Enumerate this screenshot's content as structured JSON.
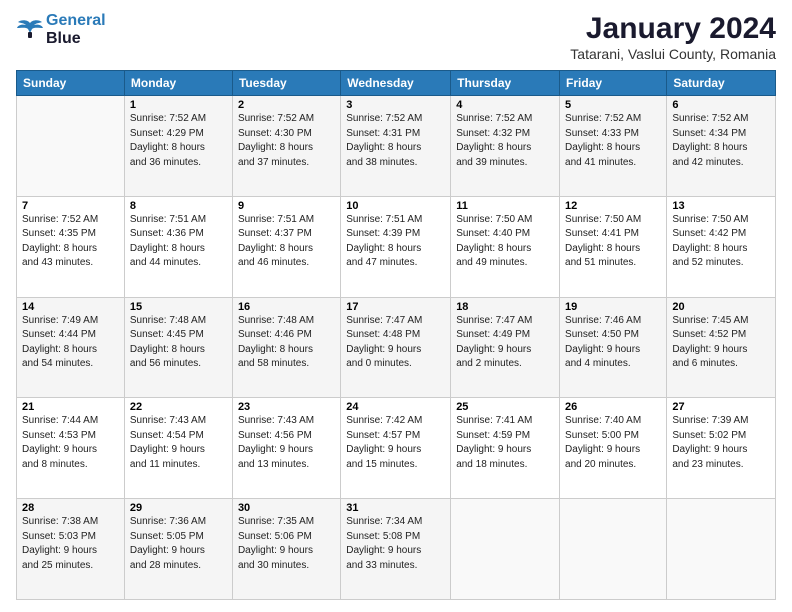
{
  "header": {
    "logo_line1": "General",
    "logo_line2": "Blue",
    "title": "January 2024",
    "subtitle": "Tatarani, Vaslui County, Romania"
  },
  "weekdays": [
    "Sunday",
    "Monday",
    "Tuesday",
    "Wednesday",
    "Thursday",
    "Friday",
    "Saturday"
  ],
  "weeks": [
    [
      {
        "day": "",
        "sunrise": "",
        "sunset": "",
        "daylight": ""
      },
      {
        "day": "1",
        "sunrise": "Sunrise: 7:52 AM",
        "sunset": "Sunset: 4:29 PM",
        "daylight": "Daylight: 8 hours and 36 minutes."
      },
      {
        "day": "2",
        "sunrise": "Sunrise: 7:52 AM",
        "sunset": "Sunset: 4:30 PM",
        "daylight": "Daylight: 8 hours and 37 minutes."
      },
      {
        "day": "3",
        "sunrise": "Sunrise: 7:52 AM",
        "sunset": "Sunset: 4:31 PM",
        "daylight": "Daylight: 8 hours and 38 minutes."
      },
      {
        "day": "4",
        "sunrise": "Sunrise: 7:52 AM",
        "sunset": "Sunset: 4:32 PM",
        "daylight": "Daylight: 8 hours and 39 minutes."
      },
      {
        "day": "5",
        "sunrise": "Sunrise: 7:52 AM",
        "sunset": "Sunset: 4:33 PM",
        "daylight": "Daylight: 8 hours and 41 minutes."
      },
      {
        "day": "6",
        "sunrise": "Sunrise: 7:52 AM",
        "sunset": "Sunset: 4:34 PM",
        "daylight": "Daylight: 8 hours and 42 minutes."
      }
    ],
    [
      {
        "day": "7",
        "sunrise": "Sunrise: 7:52 AM",
        "sunset": "Sunset: 4:35 PM",
        "daylight": "Daylight: 8 hours and 43 minutes."
      },
      {
        "day": "8",
        "sunrise": "Sunrise: 7:51 AM",
        "sunset": "Sunset: 4:36 PM",
        "daylight": "Daylight: 8 hours and 44 minutes."
      },
      {
        "day": "9",
        "sunrise": "Sunrise: 7:51 AM",
        "sunset": "Sunset: 4:37 PM",
        "daylight": "Daylight: 8 hours and 46 minutes."
      },
      {
        "day": "10",
        "sunrise": "Sunrise: 7:51 AM",
        "sunset": "Sunset: 4:39 PM",
        "daylight": "Daylight: 8 hours and 47 minutes."
      },
      {
        "day": "11",
        "sunrise": "Sunrise: 7:50 AM",
        "sunset": "Sunset: 4:40 PM",
        "daylight": "Daylight: 8 hours and 49 minutes."
      },
      {
        "day": "12",
        "sunrise": "Sunrise: 7:50 AM",
        "sunset": "Sunset: 4:41 PM",
        "daylight": "Daylight: 8 hours and 51 minutes."
      },
      {
        "day": "13",
        "sunrise": "Sunrise: 7:50 AM",
        "sunset": "Sunset: 4:42 PM",
        "daylight": "Daylight: 8 hours and 52 minutes."
      }
    ],
    [
      {
        "day": "14",
        "sunrise": "Sunrise: 7:49 AM",
        "sunset": "Sunset: 4:44 PM",
        "daylight": "Daylight: 8 hours and 54 minutes."
      },
      {
        "day": "15",
        "sunrise": "Sunrise: 7:48 AM",
        "sunset": "Sunset: 4:45 PM",
        "daylight": "Daylight: 8 hours and 56 minutes."
      },
      {
        "day": "16",
        "sunrise": "Sunrise: 7:48 AM",
        "sunset": "Sunset: 4:46 PM",
        "daylight": "Daylight: 8 hours and 58 minutes."
      },
      {
        "day": "17",
        "sunrise": "Sunrise: 7:47 AM",
        "sunset": "Sunset: 4:48 PM",
        "daylight": "Daylight: 9 hours and 0 minutes."
      },
      {
        "day": "18",
        "sunrise": "Sunrise: 7:47 AM",
        "sunset": "Sunset: 4:49 PM",
        "daylight": "Daylight: 9 hours and 2 minutes."
      },
      {
        "day": "19",
        "sunrise": "Sunrise: 7:46 AM",
        "sunset": "Sunset: 4:50 PM",
        "daylight": "Daylight: 9 hours and 4 minutes."
      },
      {
        "day": "20",
        "sunrise": "Sunrise: 7:45 AM",
        "sunset": "Sunset: 4:52 PM",
        "daylight": "Daylight: 9 hours and 6 minutes."
      }
    ],
    [
      {
        "day": "21",
        "sunrise": "Sunrise: 7:44 AM",
        "sunset": "Sunset: 4:53 PM",
        "daylight": "Daylight: 9 hours and 8 minutes."
      },
      {
        "day": "22",
        "sunrise": "Sunrise: 7:43 AM",
        "sunset": "Sunset: 4:54 PM",
        "daylight": "Daylight: 9 hours and 11 minutes."
      },
      {
        "day": "23",
        "sunrise": "Sunrise: 7:43 AM",
        "sunset": "Sunset: 4:56 PM",
        "daylight": "Daylight: 9 hours and 13 minutes."
      },
      {
        "day": "24",
        "sunrise": "Sunrise: 7:42 AM",
        "sunset": "Sunset: 4:57 PM",
        "daylight": "Daylight: 9 hours and 15 minutes."
      },
      {
        "day": "25",
        "sunrise": "Sunrise: 7:41 AM",
        "sunset": "Sunset: 4:59 PM",
        "daylight": "Daylight: 9 hours and 18 minutes."
      },
      {
        "day": "26",
        "sunrise": "Sunrise: 7:40 AM",
        "sunset": "Sunset: 5:00 PM",
        "daylight": "Daylight: 9 hours and 20 minutes."
      },
      {
        "day": "27",
        "sunrise": "Sunrise: 7:39 AM",
        "sunset": "Sunset: 5:02 PM",
        "daylight": "Daylight: 9 hours and 23 minutes."
      }
    ],
    [
      {
        "day": "28",
        "sunrise": "Sunrise: 7:38 AM",
        "sunset": "Sunset: 5:03 PM",
        "daylight": "Daylight: 9 hours and 25 minutes."
      },
      {
        "day": "29",
        "sunrise": "Sunrise: 7:36 AM",
        "sunset": "Sunset: 5:05 PM",
        "daylight": "Daylight: 9 hours and 28 minutes."
      },
      {
        "day": "30",
        "sunrise": "Sunrise: 7:35 AM",
        "sunset": "Sunset: 5:06 PM",
        "daylight": "Daylight: 9 hours and 30 minutes."
      },
      {
        "day": "31",
        "sunrise": "Sunrise: 7:34 AM",
        "sunset": "Sunset: 5:08 PM",
        "daylight": "Daylight: 9 hours and 33 minutes."
      },
      {
        "day": "",
        "sunrise": "",
        "sunset": "",
        "daylight": ""
      },
      {
        "day": "",
        "sunrise": "",
        "sunset": "",
        "daylight": ""
      },
      {
        "day": "",
        "sunrise": "",
        "sunset": "",
        "daylight": ""
      }
    ]
  ]
}
